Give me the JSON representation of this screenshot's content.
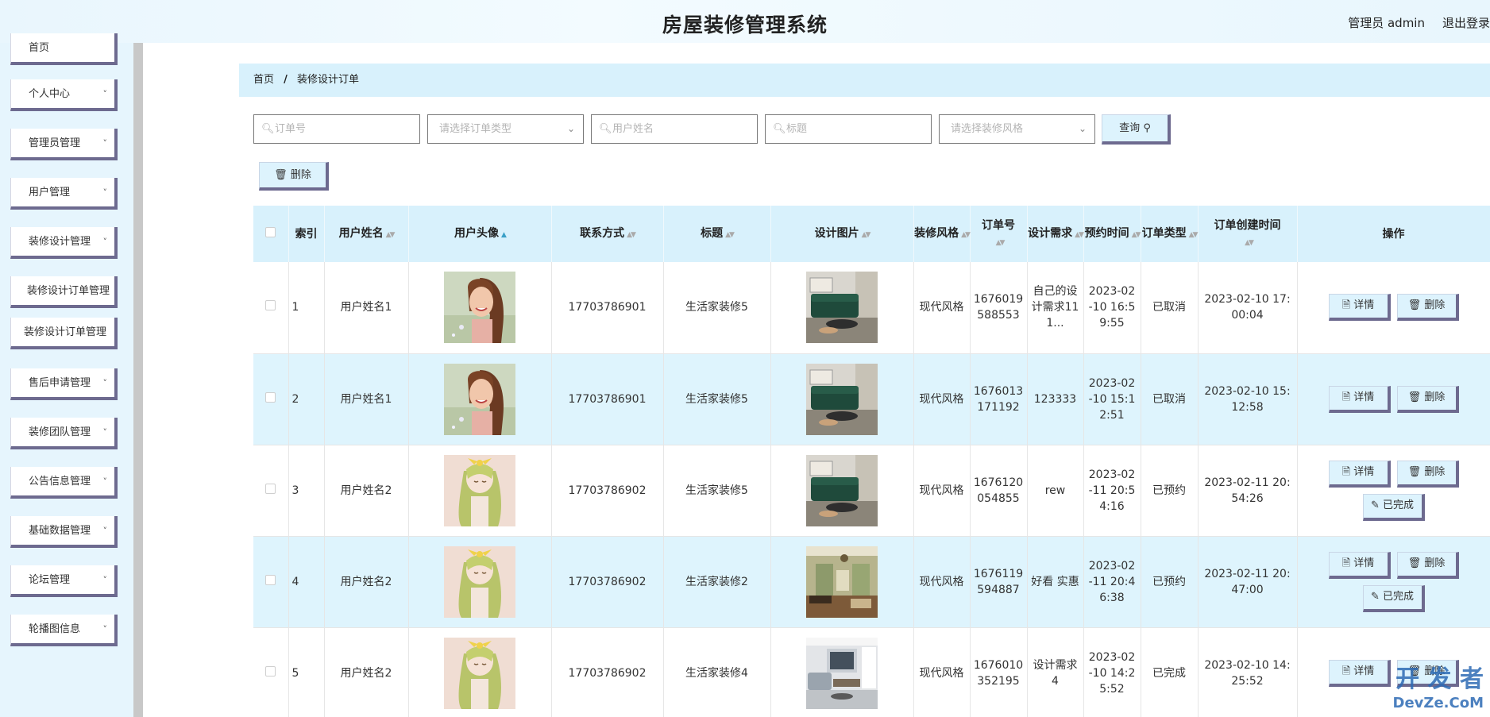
{
  "header": {
    "title": "房屋装修管理系统",
    "user": "管理员 admin",
    "logout": "退出登录"
  },
  "sidebar": {
    "items": [
      {
        "label": "首页",
        "chevron": false,
        "name": "home"
      },
      {
        "label": "个人中心",
        "chevron": true,
        "name": "personal-center"
      },
      {
        "label": "管理员管理",
        "chevron": true,
        "name": "admin-management"
      },
      {
        "label": "用户管理",
        "chevron": true,
        "name": "user-management"
      },
      {
        "label": "装修设计管理",
        "chevron": true,
        "name": "design-management"
      },
      {
        "label": "装修设计订单管理",
        "chevron": false,
        "name": "design-order-management"
      },
      {
        "label": "装修设计订单管理",
        "chevron": false,
        "name": "design-order-management-sub"
      },
      {
        "label": "售后申请管理",
        "chevron": true,
        "name": "aftersale-management"
      },
      {
        "label": "装修团队管理",
        "chevron": true,
        "name": "team-management"
      },
      {
        "label": "公告信息管理",
        "chevron": true,
        "name": "notice-management"
      },
      {
        "label": "基础数据管理",
        "chevron": true,
        "name": "base-data-management"
      },
      {
        "label": "论坛管理",
        "chevron": true,
        "name": "forum-management"
      },
      {
        "label": "轮播图信息",
        "chevron": true,
        "name": "carousel-info"
      }
    ]
  },
  "breadcrumb": {
    "home": "首页",
    "separator": "/",
    "current": "装修设计订单"
  },
  "search": {
    "order_no": "订单号",
    "order_type": "请选择订单类型",
    "user_name": "用户姓名",
    "title": "标题",
    "style": "请选择装修风格",
    "query_label": "查询"
  },
  "toolbar": {
    "delete_label": "删除"
  },
  "table": {
    "headers": {
      "index": "索引",
      "user_name": "用户姓名",
      "avatar": "用户头像",
      "phone": "联系方式",
      "title": "标题",
      "design_image": "设计图片",
      "style": "装修风格",
      "order_no": "订单号",
      "requirement": "设计需求",
      "appointment": "预约时间",
      "order_type": "订单类型",
      "created": "订单创建时间",
      "actions": "操作"
    },
    "action_labels": {
      "detail": "详情",
      "delete": "删除",
      "complete": "已完成"
    },
    "rows": [
      {
        "index": "1",
        "user_name": "用户姓名1",
        "phone": "17703786901",
        "title": "生活家装修5",
        "style": "现代风格",
        "order_no": "1676019588553",
        "requirement": "自己的设计需求111...",
        "appointment": "2023-02-10 16:59:55",
        "order_type": "已取消",
        "created": "2023-02-10 17:00:04",
        "avatar": "girl-photo",
        "image": "green-sofa",
        "complete": false
      },
      {
        "index": "2",
        "user_name": "用户姓名1",
        "phone": "17703786901",
        "title": "生活家装修5",
        "style": "现代风格",
        "order_no": "1676013171192",
        "requirement": "123333",
        "appointment": "2023-02-10 15:12:51",
        "order_type": "已取消",
        "created": "2023-02-10 15:12:58",
        "avatar": "girl-photo",
        "image": "green-sofa",
        "complete": false
      },
      {
        "index": "3",
        "user_name": "用户姓名2",
        "phone": "17703786902",
        "title": "生活家装修5",
        "style": "现代风格",
        "order_no": "1676120054855",
        "requirement": "rew",
        "appointment": "2023-02-11 20:54:16",
        "order_type": "已预约",
        "created": "2023-02-11 20:54:26",
        "avatar": "anime-girl",
        "image": "green-sofa",
        "complete": true
      },
      {
        "index": "4",
        "user_name": "用户姓名2",
        "phone": "17703786902",
        "title": "生活家装修2",
        "style": "现代风格",
        "order_no": "1676119594887",
        "requirement": "好看 实惠",
        "appointment": "2023-02-11 20:46:38",
        "order_type": "已预约",
        "created": "2023-02-11 20:47:00",
        "avatar": "anime-girl",
        "image": "living-room",
        "complete": true
      },
      {
        "index": "5",
        "user_name": "用户姓名2",
        "phone": "17703786902",
        "title": "生活家装修4",
        "style": "现代风格",
        "order_no": "1676010352195",
        "requirement": "设计需求4",
        "appointment": "2023-02-10 14:25:52",
        "order_type": "已完成",
        "created": "2023-02-10 14:25:52",
        "avatar": "anime-girl",
        "image": "grey-room",
        "complete": false
      }
    ]
  },
  "watermark": {
    "line1": "开 发 者",
    "line2": "DevZe.CoM"
  }
}
